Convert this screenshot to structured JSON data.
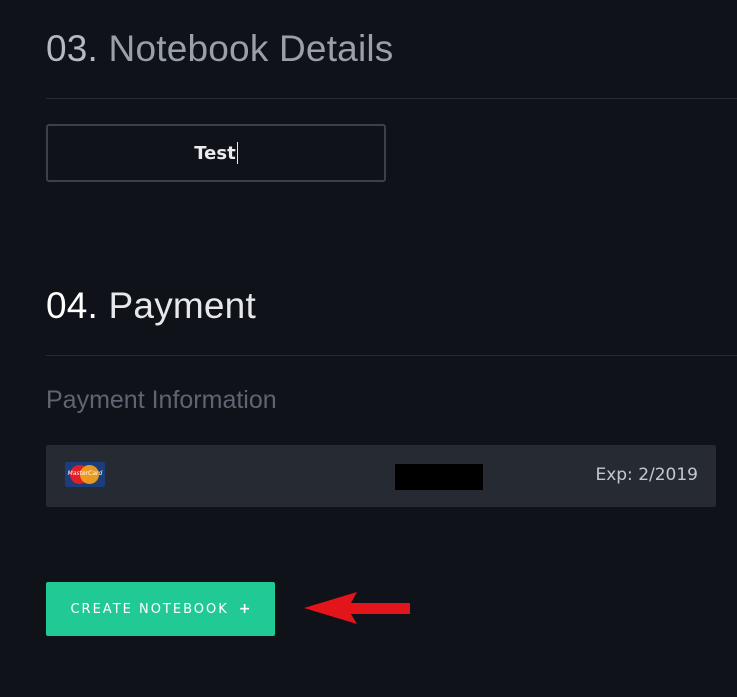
{
  "notebook_section": {
    "number": "03.",
    "title": "Notebook Details",
    "name_input_value": "Test"
  },
  "payment_section": {
    "number": "04.",
    "title": "Payment",
    "subheading": "Payment Information",
    "card": {
      "brand_icon": "mastercard-icon",
      "brand_text": "MasterCard",
      "expiry": "Exp: 2/2019"
    }
  },
  "create_button": {
    "label": "CREATE NOTEBOOK",
    "icon": "plus-icon",
    "glyph": "+",
    "color": "#21c995"
  },
  "annotation": {
    "icon": "red-arrow-icon",
    "color": "#e3151b"
  }
}
